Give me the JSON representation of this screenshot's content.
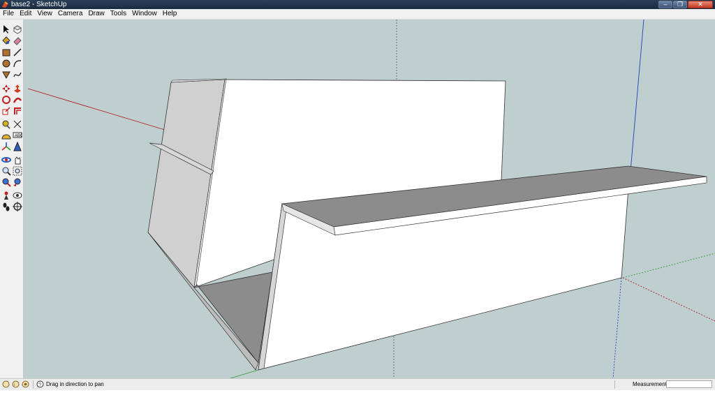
{
  "window": {
    "title": "base2 - SketchUp",
    "minimize_label": "–",
    "restore_label": "❐",
    "close_label": "✕"
  },
  "menu": [
    {
      "label": "File"
    },
    {
      "label": "Edit"
    },
    {
      "label": "View"
    },
    {
      "label": "Camera"
    },
    {
      "label": "Draw"
    },
    {
      "label": "Tools"
    },
    {
      "label": "Window"
    },
    {
      "label": "Help"
    }
  ],
  "toolbar": {
    "tools": [
      "select-icon",
      "make-component-icon",
      "paint-bucket-icon",
      "eraser-icon",
      "rectangle-icon",
      "line-icon",
      "circle-icon",
      "arc-icon",
      "polygon-icon",
      "freehand-icon",
      "move-icon",
      "push-pull-icon",
      "rotate-icon",
      "follow-me-icon",
      "scale-icon",
      "offset-icon",
      "tape-measure-icon",
      "dimension-icon",
      "protractor-icon",
      "text-icon",
      "axes-icon",
      "3d-text-icon",
      "orbit-icon",
      "pan-icon",
      "zoom-icon",
      "zoom-window-icon",
      "zoom-extents-icon",
      "previous-view-icon",
      "position-camera-icon",
      "look-around-icon",
      "walk-icon",
      "section-plane-icon"
    ]
  },
  "status": {
    "hint": "Drag in direction to pan",
    "measurements_label": "Measurements",
    "measurements_value": ""
  },
  "colors": {
    "sky_ground": "#bfcfcf",
    "face_front": "#ffffff",
    "face_side": "#d0d0d0",
    "face_dark": "#8c8c8c",
    "axis_red": "#b02020",
    "axis_green": "#3a9a3a",
    "axis_blue": "#2040c0"
  }
}
